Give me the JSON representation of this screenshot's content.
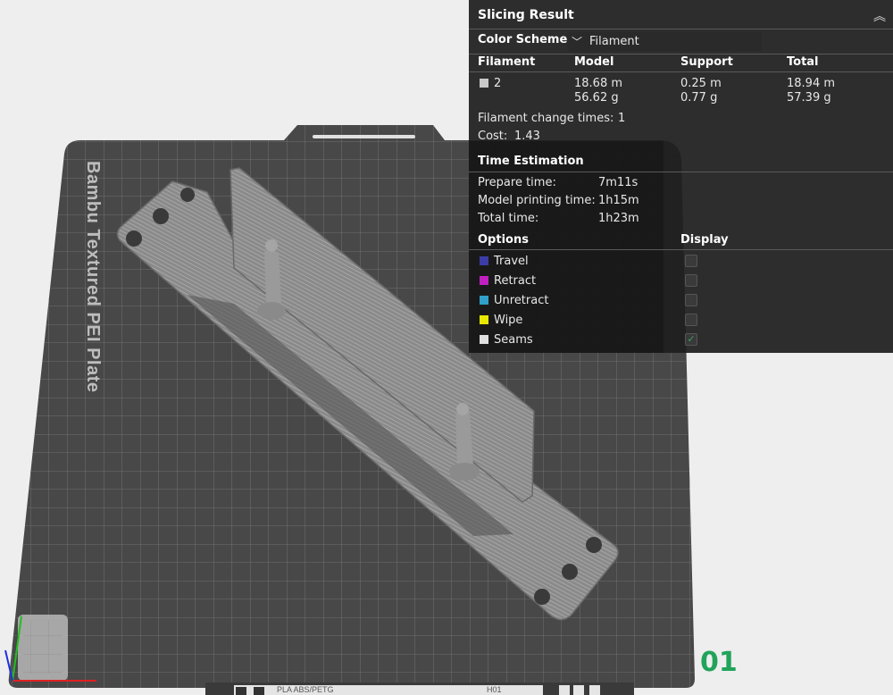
{
  "bed": {
    "label": "Bambu Textured PEI Plate"
  },
  "plate": {
    "number": "01",
    "filament_tag": "PLA ABS/PETG",
    "badge": "H01"
  },
  "slicing_result": {
    "title": "Slicing Result",
    "color_scheme_label": "Color Scheme",
    "color_scheme_value": "Filament",
    "table_headers": {
      "filament": "Filament",
      "model": "Model",
      "support": "Support",
      "total": "Total"
    },
    "row": {
      "filament": "2",
      "model_length": "18.68 m",
      "model_weight": "56.62 g",
      "support_length": "0.25 m",
      "support_weight": "0.77 g",
      "total_length": "18.94 m",
      "total_weight": "57.39 g"
    },
    "filament_change_label": "Filament change times:",
    "filament_change_value": "1",
    "cost_label": "Cost:",
    "cost_value": "1.43"
  },
  "time_estimation": {
    "title": "Time Estimation",
    "prepare_label": "Prepare time:",
    "prepare_value": "7m11s",
    "model_label": "Model printing time:",
    "model_value": "1h15m",
    "total_label": "Total time:",
    "total_value": "1h23m"
  },
  "options": {
    "title": "Options",
    "display_title": "Display",
    "items": [
      {
        "label": "Travel",
        "color": "#3c3ca8",
        "checked": false
      },
      {
        "label": "Retract",
        "color": "#c020c0",
        "checked": false
      },
      {
        "label": "Unretract",
        "color": "#30a0c8",
        "checked": false
      },
      {
        "label": "Wipe",
        "color": "#e8e800",
        "checked": false
      },
      {
        "label": "Seams",
        "color": "#e0e0e0",
        "checked": true
      }
    ]
  },
  "icons": [
    "collapse-icon",
    "chevron-down-icon",
    "checkmark-icon",
    "axes-icon"
  ]
}
